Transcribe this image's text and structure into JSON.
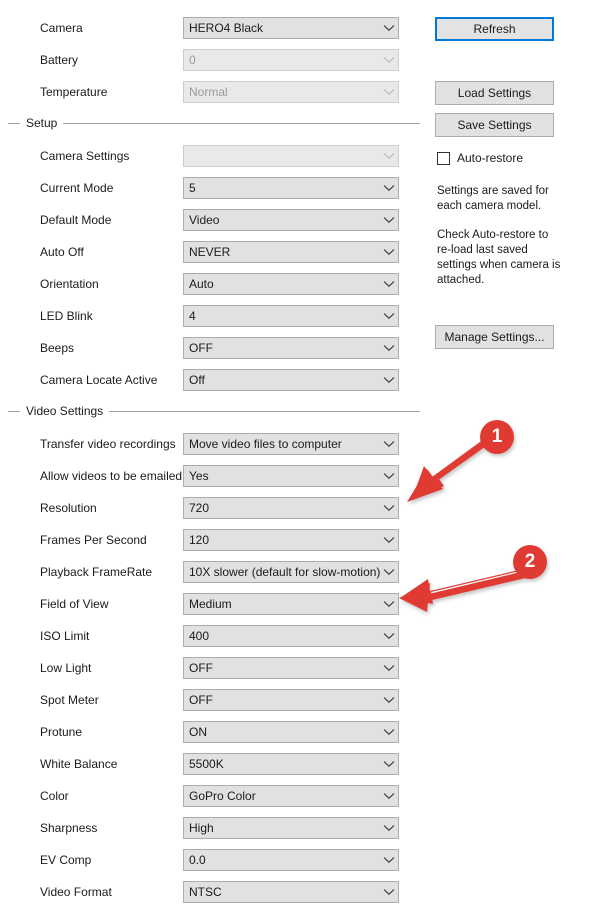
{
  "colors": {
    "accent_focus": "#0078D7",
    "annotation_red": "#E03A33",
    "combo_fill": "#E1E1E1",
    "combo_border": "#ACACAC",
    "group_line": "#A0A0A0",
    "text": "#1B1B1B",
    "disabled_text": "#9A9A9A"
  },
  "camera_section": {
    "rows": [
      {
        "label": "Camera",
        "value": "HERO4 Black",
        "disabled": false
      },
      {
        "label": "Battery",
        "value": "0",
        "disabled": true
      },
      {
        "label": "Temperature",
        "value": "Normal",
        "disabled": true
      }
    ]
  },
  "setup_section": {
    "title": "Setup",
    "rows": [
      {
        "label": "Camera Settings",
        "value": "",
        "disabled": true
      },
      {
        "label": "Current Mode",
        "value": "5",
        "disabled": false
      },
      {
        "label": "Default Mode",
        "value": "Video",
        "disabled": false
      },
      {
        "label": "Auto Off",
        "value": "NEVER",
        "disabled": false
      },
      {
        "label": "Orientation",
        "value": "Auto",
        "disabled": false
      },
      {
        "label": "LED Blink",
        "value": "4",
        "disabled": false
      },
      {
        "label": "Beeps",
        "value": "OFF",
        "disabled": false
      },
      {
        "label": "Camera Locate Active",
        "value": "Off",
        "disabled": false
      }
    ]
  },
  "video_section": {
    "title": "Video Settings",
    "rows": [
      {
        "label": "Transfer video recordings",
        "value": "Move video files to computer",
        "disabled": false
      },
      {
        "label": "Allow videos to be emailed",
        "value": "Yes",
        "disabled": false
      },
      {
        "label": "Resolution",
        "value": "720",
        "disabled": false
      },
      {
        "label": "Frames Per Second",
        "value": "120",
        "disabled": false
      },
      {
        "label": "Playback FrameRate",
        "value": "10X slower (default for slow-motion)",
        "disabled": false
      },
      {
        "label": "Field of View",
        "value": "Medium",
        "disabled": false
      },
      {
        "label": "ISO Limit",
        "value": "400",
        "disabled": false
      },
      {
        "label": "Low Light",
        "value": "OFF",
        "disabled": false
      },
      {
        "label": "Spot Meter",
        "value": "OFF",
        "disabled": false
      },
      {
        "label": "Protune",
        "value": "ON",
        "disabled": false
      },
      {
        "label": "White Balance",
        "value": "5500K",
        "disabled": false
      },
      {
        "label": "Color",
        "value": "GoPro Color",
        "disabled": false
      },
      {
        "label": "Sharpness",
        "value": "High",
        "disabled": false
      },
      {
        "label": "EV Comp",
        "value": "0.0",
        "disabled": false
      },
      {
        "label": "Video Format",
        "value": "NTSC",
        "disabled": false
      }
    ]
  },
  "side_panel": {
    "buttons": [
      {
        "label": "Refresh",
        "focused": true
      },
      {
        "label": "Load Settings",
        "focused": false
      },
      {
        "label": "Save Settings",
        "focused": false
      },
      {
        "label": "Manage Settings...",
        "focused": false
      }
    ],
    "auto_restore": {
      "label": "Auto-restore",
      "checked": false
    },
    "info_paragraph_1": "Settings are saved for each camera model.",
    "info_paragraph_2": "Check Auto-restore to re-load last saved settings when camera is attached."
  },
  "annotations": [
    {
      "number": "1",
      "target": "Resolution"
    },
    {
      "number": "2",
      "target": "Field of View"
    }
  ]
}
